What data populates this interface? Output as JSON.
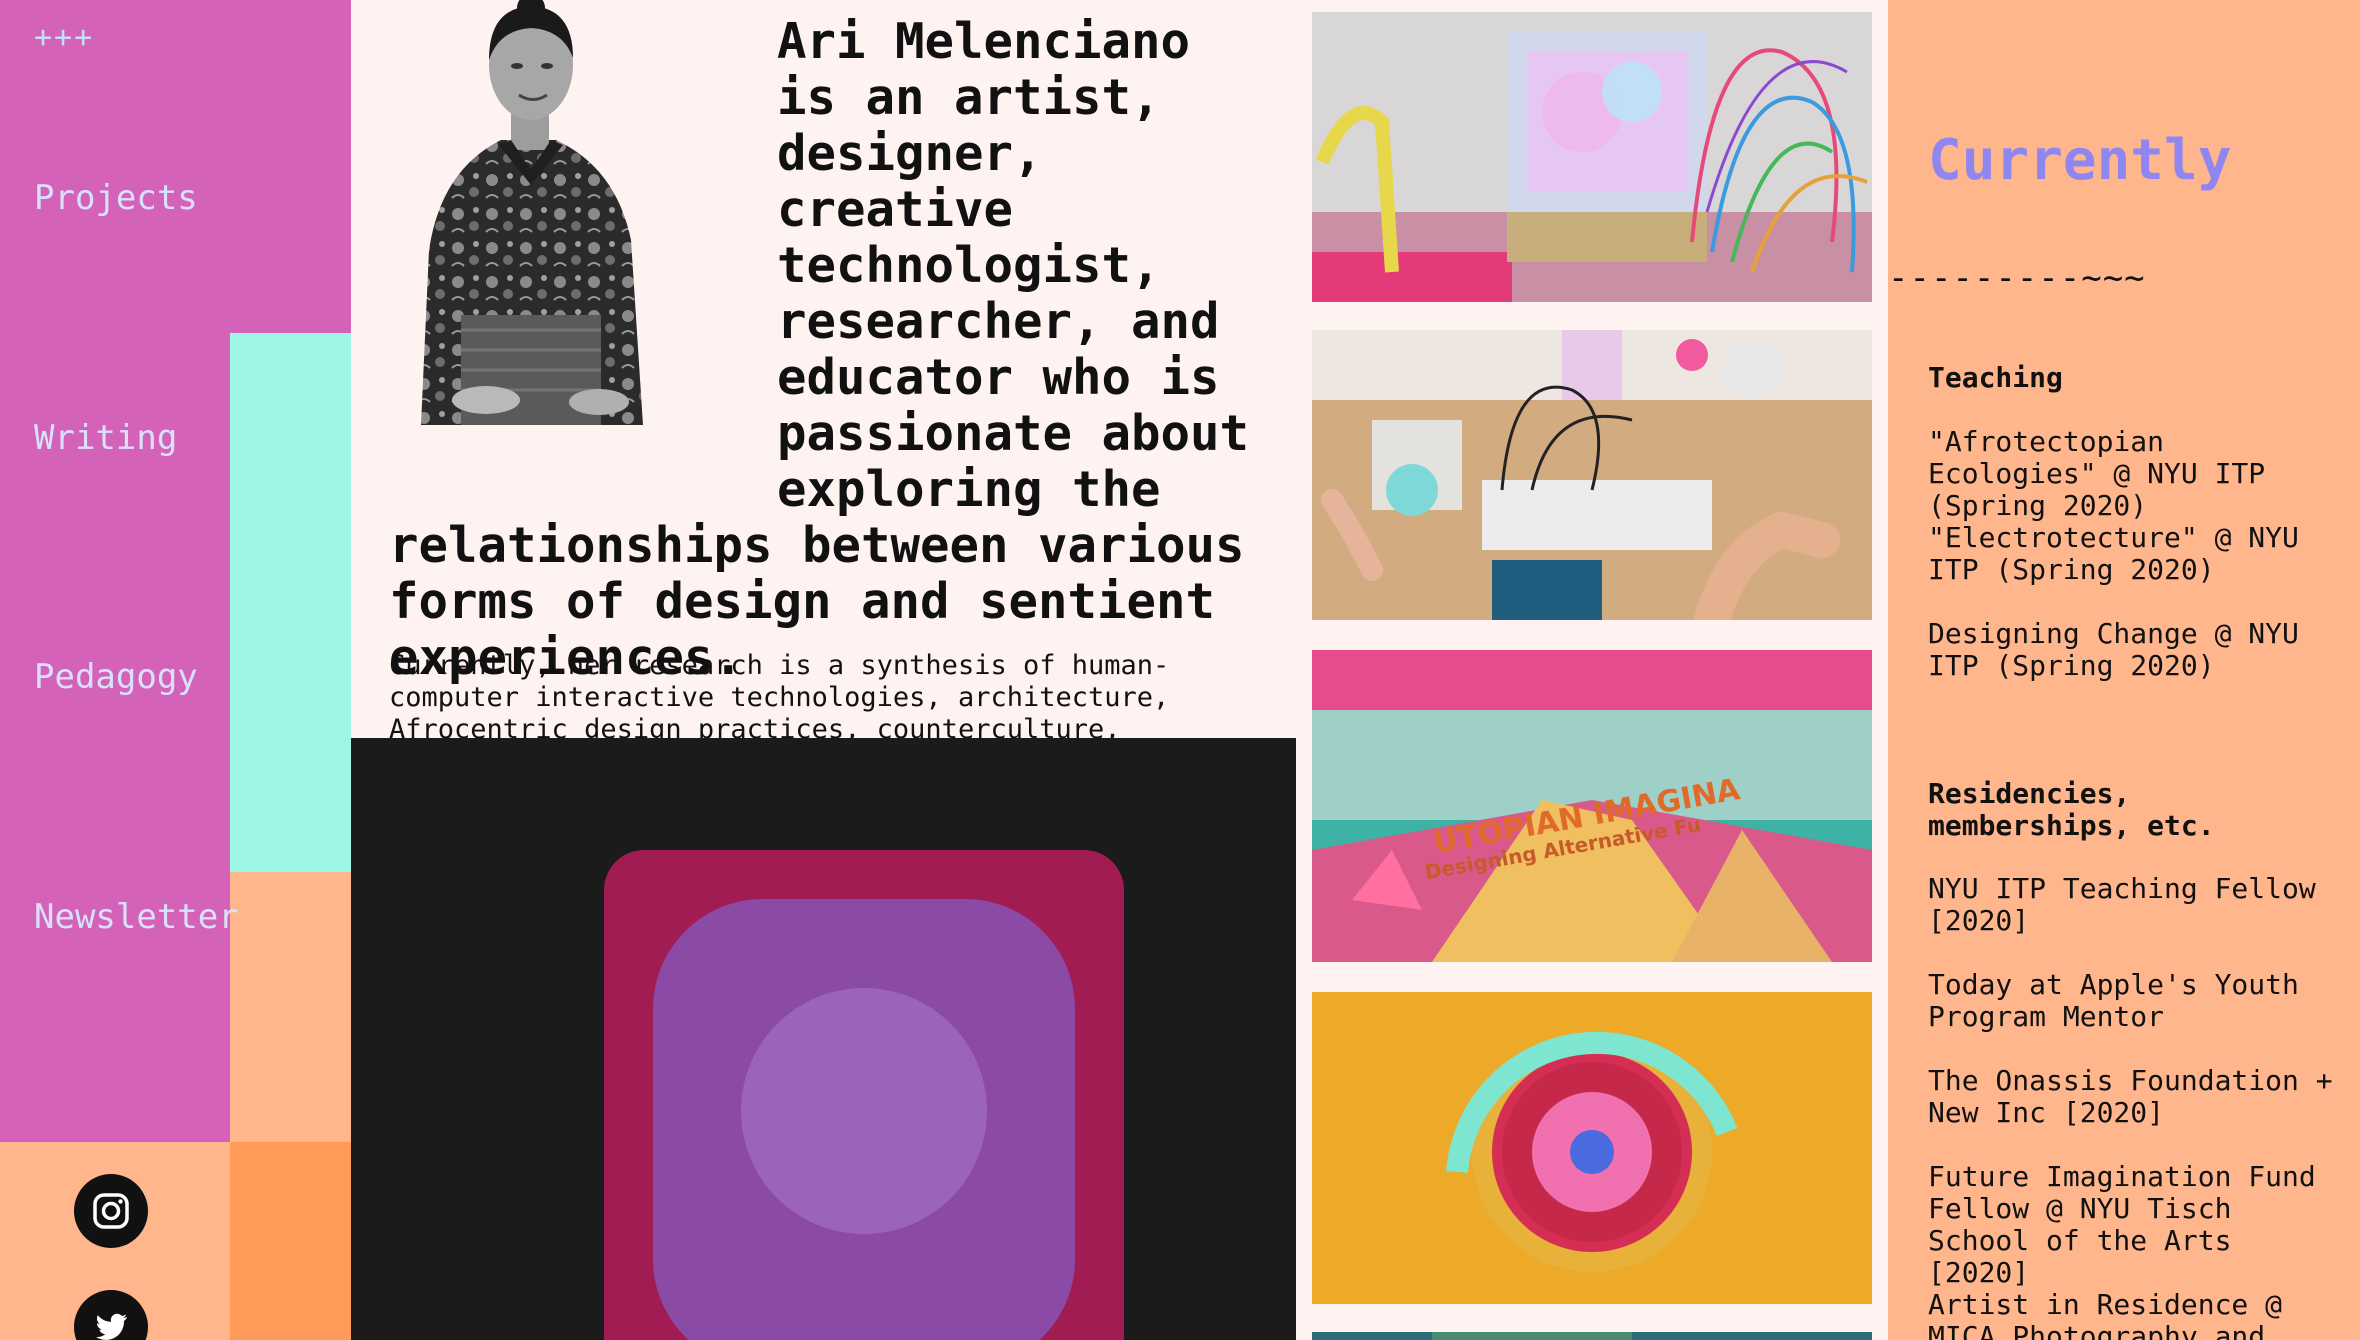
{
  "sidebar": {
    "logo": "+++",
    "nav": [
      {
        "label": "Projects"
      },
      {
        "label": "Writing"
      },
      {
        "label": "Pedagogy"
      },
      {
        "label": "Newsletter"
      }
    ],
    "social": [
      {
        "icon": "instagram-icon"
      },
      {
        "icon": "twitter-icon"
      }
    ],
    "colors": {
      "magenta": "#d462b8",
      "teal": "#9ef6e6",
      "peach": "#ffb68c",
      "orange": "#ff9a58"
    }
  },
  "intro": {
    "headline": "Ari Melenciano is an artist, designer, creative technologist, researcher, and educator who is passionate about exploring the relationships between various forms of design and sentient experiences.",
    "paragraph": "Currently, her research is a synthesis of human-computer interactive technologies, architecture, Afrocentric design practices, counterculture,"
  },
  "thumbnails": [
    {
      "icon": "electronics-sculpture-image"
    },
    {
      "icon": "breadboard-arduino-image"
    },
    {
      "icon": "utopian-imaginaries-image"
    },
    {
      "icon": "abstract-ring-image"
    },
    {
      "icon": "partial-thumbnail-image"
    }
  ],
  "currently": {
    "title": "Currently",
    "divider": "---------~~~",
    "sections": [
      {
        "heading": "Teaching",
        "items": [
          "\"Afrotectopian Ecologies\" @ NYU ITP (Spring 2020)",
          "\"Electrotecture\" @ NYU ITP (Spring 2020)",
          "Designing Change @ NYU ITP (Spring 2020)"
        ]
      },
      {
        "heading": "Residencies, memberships, etc.",
        "items": [
          "NYU ITP Teaching Fellow [2020]",
          "Today at Apple's Youth Program Mentor",
          "The Onassis Foundation + New Inc [2020]",
          "Future Imagination Fund Fellow @ NYU Tisch School of the Arts [2020]",
          "Artist in Residence @ MICA Photography and"
        ]
      }
    ],
    "accent": "#8f86f2"
  }
}
